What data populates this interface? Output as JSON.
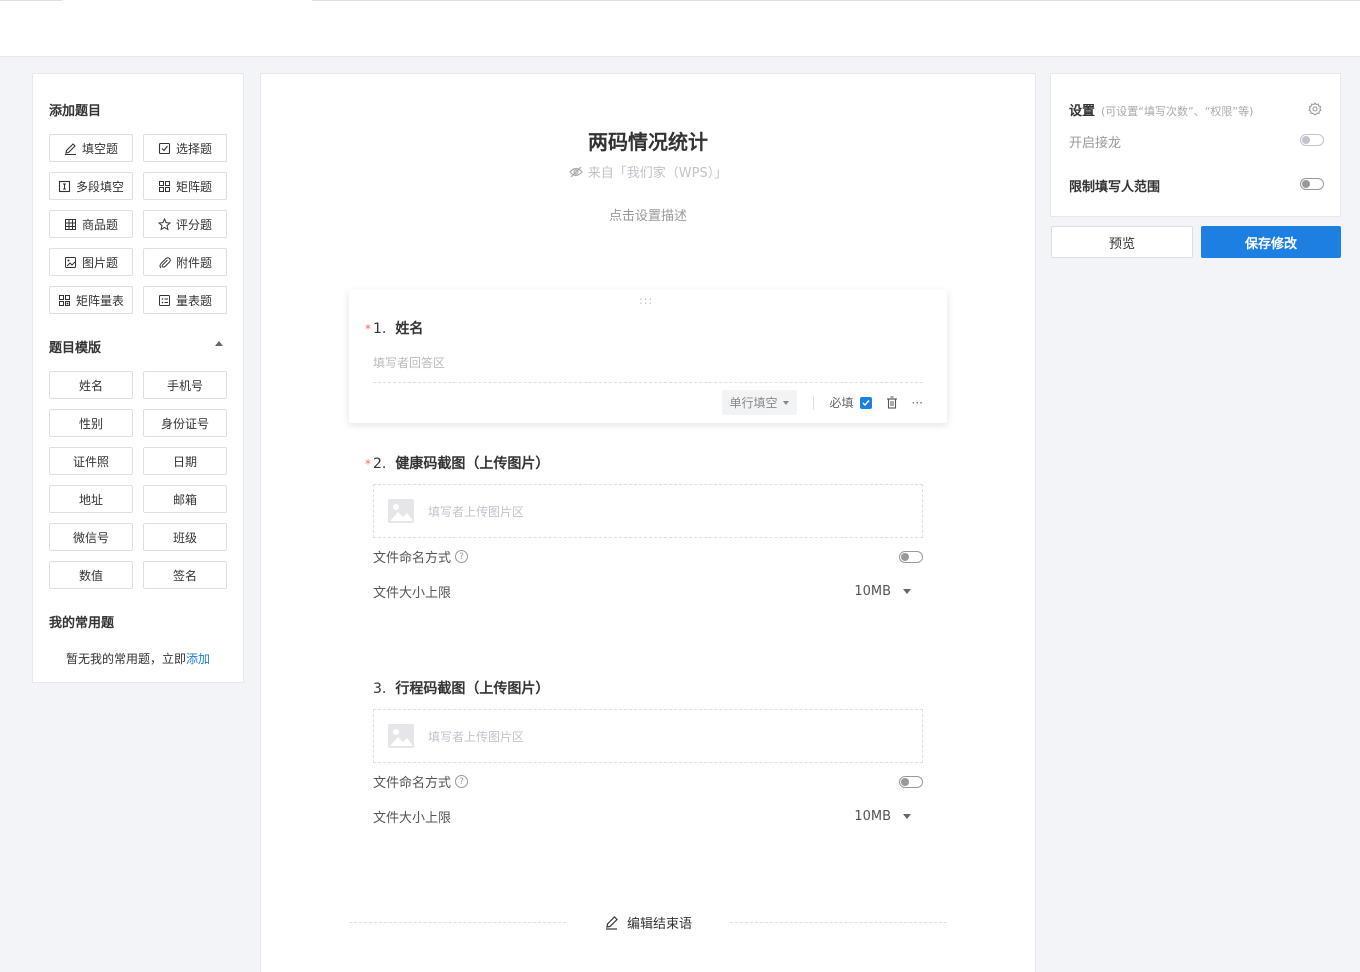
{
  "left_panel": {
    "add_title": "添加题目",
    "question_types": [
      {
        "label": "填空题",
        "icon": "pencil-icon"
      },
      {
        "label": "选择题",
        "icon": "checkbox-icon"
      },
      {
        "label": "多段填空",
        "icon": "text-cursor-icon"
      },
      {
        "label": "矩阵题",
        "icon": "matrix-icon"
      },
      {
        "label": "商品题",
        "icon": "table-icon"
      },
      {
        "label": "评分题",
        "icon": "star-icon"
      },
      {
        "label": "图片题",
        "icon": "image-icon"
      },
      {
        "label": "附件题",
        "icon": "paperclip-icon"
      },
      {
        "label": "矩阵量表",
        "icon": "matrix-scale-icon"
      },
      {
        "label": "量表题",
        "icon": "scale-icon"
      }
    ],
    "template_title": "题目模版",
    "templates": [
      "姓名",
      "手机号",
      "性别",
      "身份证号",
      "证件照",
      "日期",
      "地址",
      "邮箱",
      "微信号",
      "班级",
      "数值",
      "签名"
    ],
    "common_title": "我的常用题",
    "common_empty": "暂无我的常用题，立即",
    "common_add": "添加"
  },
  "form": {
    "title": "两码情况统计",
    "source": "来自「我们家（WPS）」",
    "description": "点击设置描述",
    "drag_handle": ":::",
    "questions": [
      {
        "required": "*",
        "number": "1.",
        "title": "姓名",
        "answer_placeholder": "填写者回答区",
        "type_label": "单行填空",
        "required_label": "必填",
        "more": "···"
      },
      {
        "required": "*",
        "number": "2.",
        "title": "健康码截图（上传图片）",
        "upload_placeholder": "填写者上传图片区",
        "naming_label": "文件命名方式",
        "size_label": "文件大小上限",
        "size_value": "10MB"
      },
      {
        "required": "",
        "number": "3.",
        "title": "行程码截图（上传图片）",
        "upload_placeholder": "填写者上传图片区",
        "naming_label": "文件命名方式",
        "size_label": "文件大小上限",
        "size_value": "10MB"
      }
    ],
    "end_label": "编辑结束语"
  },
  "settings": {
    "title": "设置",
    "subtitle": "(可设置“填写次数”、“权限”等)",
    "relay_label": "开启接龙",
    "limit_label": "限制填写人范围"
  },
  "actions": {
    "preview": "预览",
    "save": "保存修改"
  },
  "colors": {
    "accent": "#1d7fe2",
    "required": "#f56c6c"
  }
}
